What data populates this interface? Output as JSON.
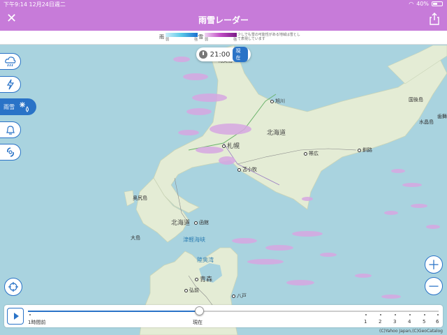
{
  "status": {
    "time": "下午9:14",
    "date": "12月24日週二",
    "battery": "40%"
  },
  "nav": {
    "title": "雨雪レーダー",
    "close": "✕",
    "share": "share-icon"
  },
  "legend": {
    "rain_label": "雨",
    "snow_label": "雪",
    "rain_weak": "弱",
    "rain_strong": "強",
    "snow_weak": "弱",
    "snow_strong": "強",
    "note": "少しでも雪の可能性がある地域は雪として表現しています",
    "rain_color": "#5ac8e8",
    "snow_color": "#c04cc4"
  },
  "time": {
    "value": "21:00",
    "badge": "現在"
  },
  "side": {
    "active_label": "雨雪"
  },
  "places": {
    "asahikawa": "旭川",
    "sapporo": "札幌",
    "hokkaido": "北海道",
    "obihiro": "帯広",
    "kushiro": "釧路",
    "tomakomai": "苫小牧",
    "okushiri": "奥尻島",
    "hokkaido2": "北海道",
    "hakodate": "函館",
    "oshima": "大島",
    "tsugaru": "津軽海峡",
    "mutsu": "陸奥湾",
    "aomori": "青森",
    "hirosaki": "弘前",
    "hachinohe": "八戸",
    "kunashiri": "国後島",
    "mizushojima": "水晶島",
    "habomai": "歯舞",
    "rebun": "礼文島"
  },
  "timeline": {
    "labels": [
      "1時間前",
      "現在",
      "1",
      "2",
      "3",
      "4",
      "5",
      "6"
    ],
    "progress": 0.415
  },
  "copyright": "(C)Yahoo Japan,(C)GeoCatalog"
}
